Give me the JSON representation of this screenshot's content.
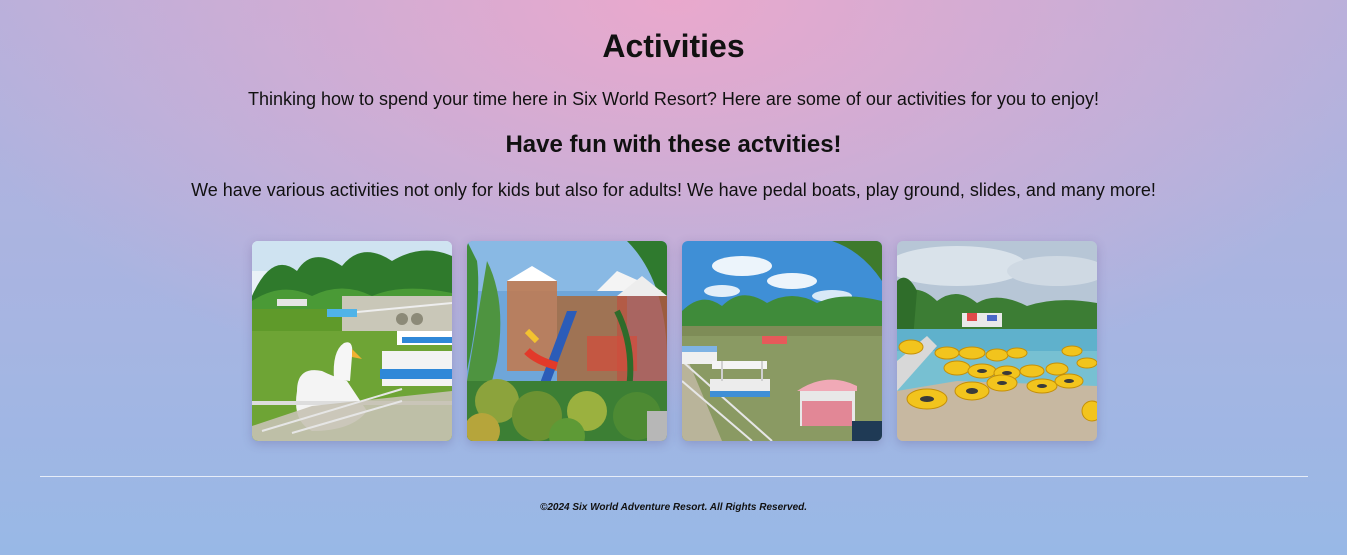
{
  "page": {
    "title": "Activities",
    "intro": "Thinking how to spend your time here in Six World Resort? Here are some of our activities for you to enjoy!",
    "subtitle": "Have fun with these actvities!",
    "description": "We have various activities not only for kids but also for adults! We have pedal boats, play ground, slides, and many more!"
  },
  "gallery": [
    {
      "name": "swan-pedal-boats-photo"
    },
    {
      "name": "playground-photo"
    },
    {
      "name": "pedal-boats-river-photo"
    },
    {
      "name": "pool-inner-tubes-photo"
    }
  ],
  "footer": {
    "copyright": "©2024 Six World Adventure Resort. All Rights Reserved."
  }
}
